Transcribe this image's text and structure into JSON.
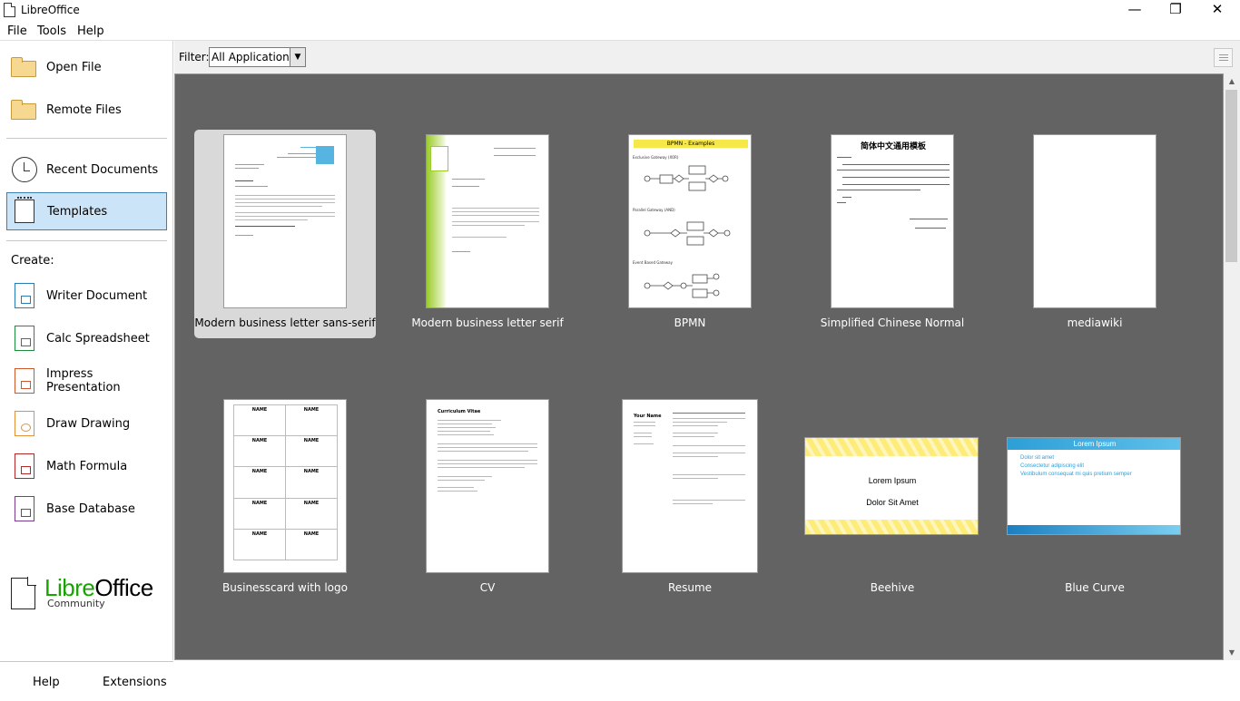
{
  "window": {
    "title": "LibreOffice",
    "minimize": "—",
    "maximize": "❐",
    "close": "✕"
  },
  "menu": {
    "file": "File",
    "tools": "Tools",
    "help": "Help"
  },
  "sidebar": {
    "open_file": "Open File",
    "remote_files": "Remote Files",
    "recent_documents": "Recent Documents",
    "templates": "Templates",
    "create_label": "Create:",
    "create_items": [
      {
        "label": "Writer Document",
        "color": "#2a7ab8"
      },
      {
        "label": "Calc Spreadsheet",
        "color": "#1e8e3e"
      },
      {
        "label": "Impress Presentation",
        "color": "#d0572b"
      },
      {
        "label": "Draw Drawing",
        "color": "#e3903a"
      },
      {
        "label": "Math Formula",
        "color": "#b5282a"
      },
      {
        "label": "Base Database",
        "color": "#7b3b8f"
      }
    ],
    "logo_main_a": "Libre",
    "logo_main_b": "Office",
    "logo_sub": "Community",
    "footer_help": "Help",
    "footer_extensions": "Extensions"
  },
  "filter": {
    "label": "Filter:",
    "value": "All Applications"
  },
  "templates": [
    {
      "name": "Modern business letter sans-serif",
      "selected": true
    },
    {
      "name": "Modern business letter serif",
      "selected": false
    },
    {
      "name": "BPMN",
      "selected": false
    },
    {
      "name": "Simplified Chinese Normal",
      "selected": false
    },
    {
      "name": "mediawiki",
      "selected": false
    },
    {
      "name": "Businesscard with logo",
      "selected": false
    },
    {
      "name": "CV",
      "selected": false
    },
    {
      "name": "Resume",
      "selected": false
    },
    {
      "name": "Beehive",
      "selected": false
    },
    {
      "name": "Blue Curve",
      "selected": false
    }
  ],
  "thumb_text": {
    "bpmn_title": "BPMN - Examples",
    "chinese_title": "简体中文通用模板",
    "beehive_line1": "Lorem Ipsum",
    "beehive_line2": "Dolor Sit Amet",
    "bluecurve_title": "Lorem Ipsum",
    "bluecurve_b1": "Dolor sit amet",
    "bluecurve_b2": "Consectetur adipiscing elit",
    "bluecurve_b3": "Vestibulum consequat mi quis pretium semper",
    "card_name": "NAME",
    "cv_title": "Curriculum Vitae",
    "resume_name": "Your Name"
  }
}
